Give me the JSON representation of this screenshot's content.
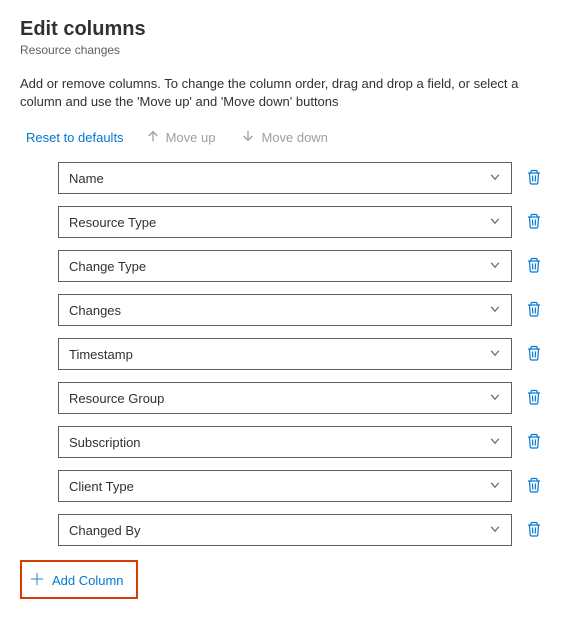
{
  "header": {
    "title": "Edit columns",
    "subtitle": "Resource changes"
  },
  "instructions": "Add or remove columns. To change the column order, drag and drop a field, or select a column and use the 'Move up' and 'Move down' buttons",
  "toolbar": {
    "reset": "Reset to defaults",
    "move_up": "Move up",
    "move_down": "Move down"
  },
  "columns": [
    {
      "label": "Name"
    },
    {
      "label": "Resource Type"
    },
    {
      "label": "Change Type"
    },
    {
      "label": "Changes"
    },
    {
      "label": "Timestamp"
    },
    {
      "label": "Resource Group"
    },
    {
      "label": "Subscription"
    },
    {
      "label": "Client Type"
    },
    {
      "label": "Changed By"
    }
  ],
  "actions": {
    "add_column": "Add Column"
  }
}
